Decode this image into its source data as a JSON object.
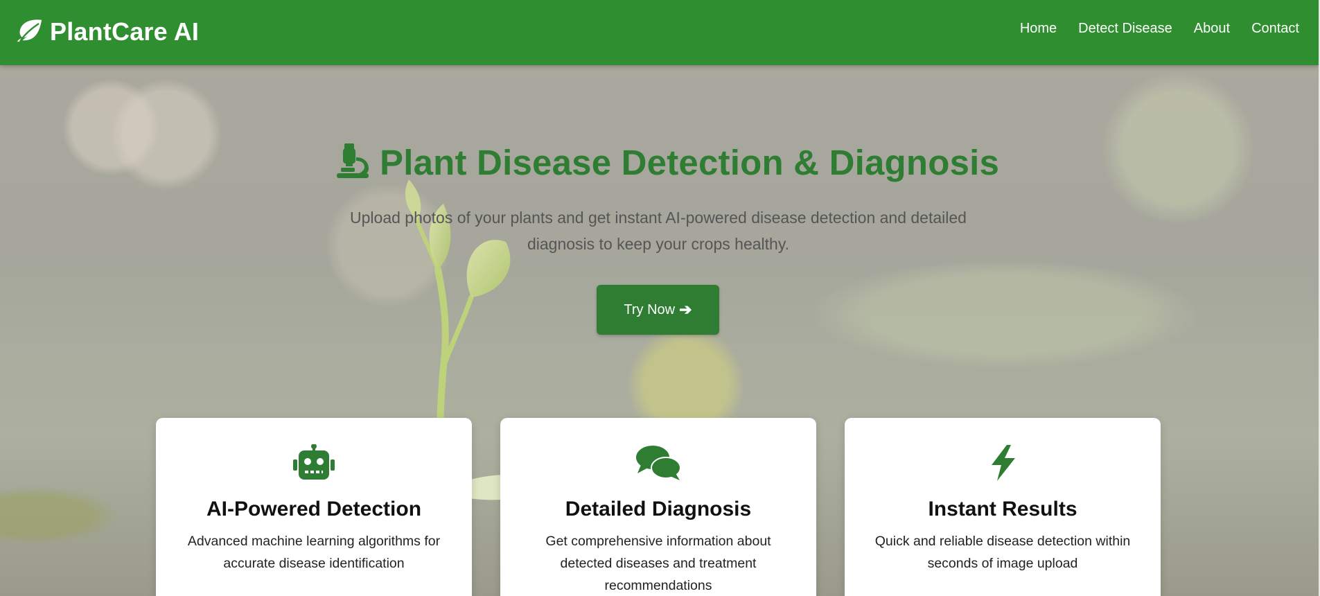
{
  "brand": {
    "name": "PlantCare AI",
    "icon": "leaf-icon"
  },
  "nav": {
    "items": [
      {
        "label": "Home"
      },
      {
        "label": "Detect Disease"
      },
      {
        "label": "About"
      },
      {
        "label": "Contact"
      }
    ]
  },
  "hero": {
    "title": "Plant Disease Detection & Diagnosis",
    "title_icon": "microscope-icon",
    "subtitle": "Upload photos of your plants and get instant AI-powered disease detection and detailed diagnosis to keep your crops healthy.",
    "cta_label": "Try Now",
    "cta_icon": "arrow-right-icon"
  },
  "features": [
    {
      "icon": "robot-icon",
      "title": "AI-Powered Detection",
      "text": "Advanced machine learning algorithms for accurate disease identification"
    },
    {
      "icon": "comments-icon",
      "title": "Detailed Diagnosis",
      "text": "Get comprehensive information about detected diseases and treatment recommendations"
    },
    {
      "icon": "bolt-icon",
      "title": "Instant Results",
      "text": "Quick and reliable disease detection within seconds of image upload"
    }
  ],
  "colors": {
    "primary": "#2e7d32",
    "navbar": "#2f8f30",
    "card_bg": "#ffffff",
    "subtitle_text": "#555555"
  }
}
